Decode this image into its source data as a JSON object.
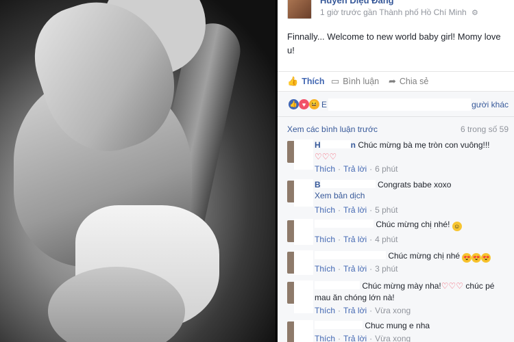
{
  "post": {
    "author": "Huyền Diệu Đăng",
    "meta": "1 giờ trước gần Thành phố Hồ Chí Minh",
    "text": "Finnally... Welcome to new world baby girl! Momy love u!"
  },
  "actions": {
    "like": "Thích",
    "comment": "Bình luận",
    "share": "Chia sẻ"
  },
  "reactions": {
    "names_start": "E",
    "others": "gười khác"
  },
  "comments_header": {
    "view_more": "Xem các bình luận trước",
    "count": "6 trong số 59"
  },
  "comments": [
    {
      "name": "H",
      "suffix": "n",
      "text": "Chúc mừng bà mẹ tròn con vuông!!!",
      "like": "Thích",
      "reply": "Trả lời",
      "time": "6 phút"
    },
    {
      "name": "B",
      "text": "Congrats babe xoxo",
      "see_translation": "Xem bản dịch",
      "like": "Thích",
      "reply": "Trả lời",
      "time": "5 phút"
    },
    {
      "text": "Chúc mừng chị nhé!",
      "like": "Thích",
      "reply": "Trả lời",
      "time": "4 phút"
    },
    {
      "text": "Chúc mừng chị nhé",
      "like": "Thích",
      "reply": "Trả lời",
      "time": "3 phút"
    },
    {
      "text": "Chúc mừng mày nha!",
      "text2": "chúc pé mau ăn chóng lớn nà!",
      "like": "Thích",
      "reply": "Trả lời",
      "time": "Vừa xong"
    },
    {
      "text": "Chuc mung e nha",
      "like": "Thích",
      "reply": "Trả lời",
      "time": "Vừa xong"
    }
  ],
  "colors": {
    "link": "#365899",
    "accent": "#4267b2",
    "muted": "#90949c",
    "heart": "#f25268"
  }
}
